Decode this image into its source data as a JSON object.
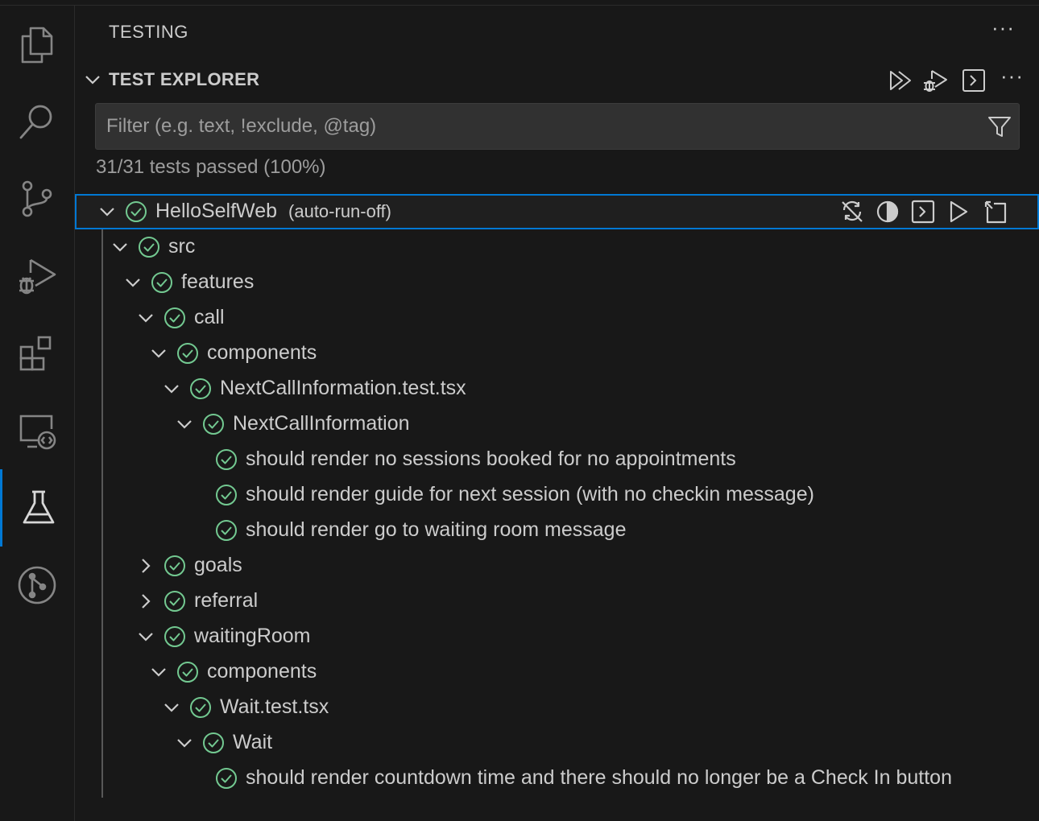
{
  "activity_bar": {
    "items": [
      {
        "icon": "files-icon"
      },
      {
        "icon": "search-icon"
      },
      {
        "icon": "source-control-icon"
      },
      {
        "icon": "run-debug-icon"
      },
      {
        "icon": "extensions-icon"
      },
      {
        "icon": "remote-explorer-icon"
      },
      {
        "icon": "testing-icon",
        "active": true
      },
      {
        "icon": "git-graph-icon"
      }
    ]
  },
  "panel": {
    "title": "TESTING",
    "more": "···"
  },
  "section": {
    "title": "TEST EXPLORER",
    "more": "···"
  },
  "filter": {
    "placeholder": "Filter (e.g. text, !exclude, @tag)",
    "value": ""
  },
  "summary": "31/31 tests passed (100%)",
  "tree": [
    {
      "label": "HelloSelfWeb",
      "description": "(auto-run-off)",
      "depth": 0,
      "expanded": true,
      "selected": true
    },
    {
      "label": "src",
      "depth": 1,
      "expanded": true
    },
    {
      "label": "features",
      "depth": 2,
      "expanded": true
    },
    {
      "label": "call",
      "depth": 3,
      "expanded": true
    },
    {
      "label": "components",
      "depth": 4,
      "expanded": true
    },
    {
      "label": "NextCallInformation.test.tsx",
      "depth": 5,
      "expanded": true
    },
    {
      "label": "NextCallInformation",
      "depth": 6,
      "expanded": true
    },
    {
      "label": "should render no sessions booked for no appointments",
      "depth": 7,
      "leaf": true
    },
    {
      "label": "should render guide for next session (with no checkin message)",
      "depth": 7,
      "leaf": true
    },
    {
      "label": "should render go to waiting room message",
      "depth": 7,
      "leaf": true
    },
    {
      "label": "goals",
      "depth": 3,
      "expanded": false
    },
    {
      "label": "referral",
      "depth": 3,
      "expanded": false
    },
    {
      "label": "waitingRoom",
      "depth": 3,
      "expanded": true
    },
    {
      "label": "components",
      "depth": 4,
      "expanded": true
    },
    {
      "label": "Wait.test.tsx",
      "depth": 5,
      "expanded": true
    },
    {
      "label": "Wait",
      "depth": 6,
      "expanded": true
    },
    {
      "label": "should render countdown time and there should no longer be a Check In button",
      "depth": 7,
      "leaf": true
    }
  ],
  "colors": {
    "passed": "#73c991",
    "accent": "#0078d4",
    "background": "#181818"
  }
}
